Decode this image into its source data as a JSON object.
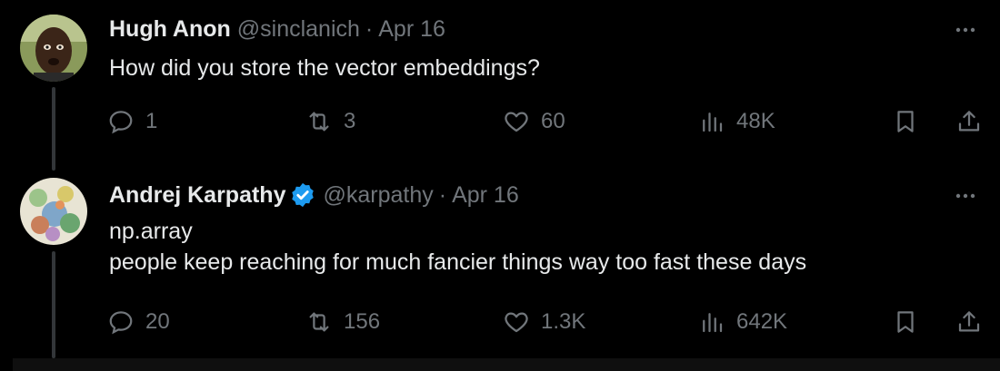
{
  "tweets": [
    {
      "name": "Hugh Anon",
      "handle": "@sinclanich",
      "separator": "·",
      "date": "Apr 16",
      "verified": false,
      "lines": [
        "How did you store the vector embeddings?"
      ],
      "stats": {
        "replies": "1",
        "retweets": "3",
        "likes": "60",
        "views": "48K"
      },
      "avatar_icon": "person-avatar"
    },
    {
      "name": "Andrej Karpathy",
      "handle": "@karpathy",
      "separator": "·",
      "date": "Apr 16",
      "verified": true,
      "lines": [
        "np.array",
        "people keep reaching for much fancier things way too fast these days"
      ],
      "stats": {
        "replies": "20",
        "retweets": "156",
        "likes": "1.3K",
        "views": "642K"
      },
      "avatar_icon": "painting-avatar"
    }
  ],
  "colors": {
    "background": "#000000",
    "text": "#e7e9ea",
    "muted": "#71767b",
    "verified_blue": "#1d9bf0",
    "thread_line": "#333639"
  }
}
